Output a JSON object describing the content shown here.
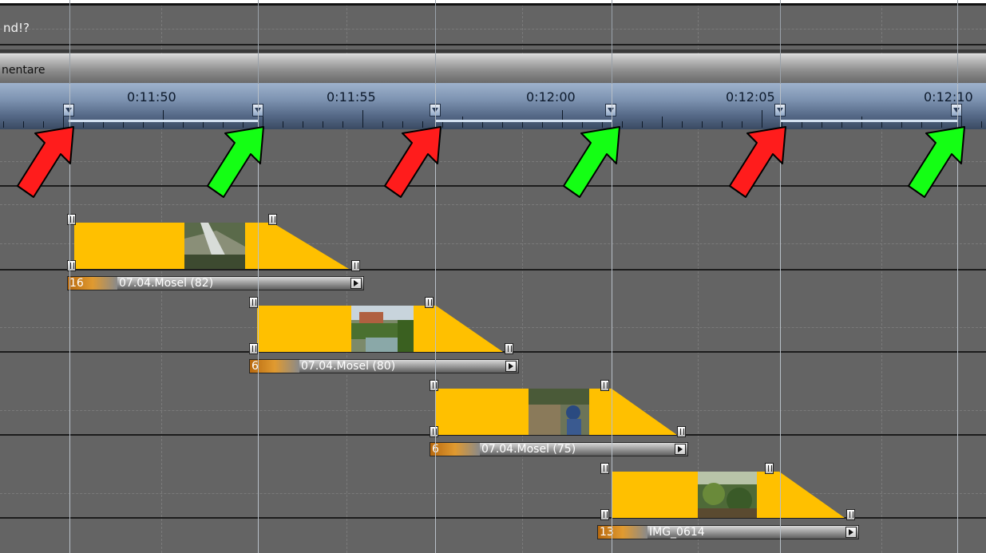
{
  "track_title": "nd!?",
  "comment_track_label": "nentare",
  "ruler": {
    "time_labels": [
      "0:11:50",
      "0:11:55",
      "0:12:00",
      "0:12:05",
      "0:12:10"
    ]
  },
  "annotation_arrows": [
    "red",
    "green",
    "red",
    "green",
    "red",
    "green"
  ],
  "colors": {
    "background": "#646464",
    "clip_fill": "#ffc000",
    "arrow_red": "#ff1c1c",
    "arrow_green": "#14ff14",
    "ruler": "#7e94b2"
  },
  "clips": [
    {
      "number": "16",
      "name": "07.04.Mosel (82)"
    },
    {
      "number": "6",
      "name": "07.04.Mosel (80)"
    },
    {
      "number": "6",
      "name": "07.04.Mosel (75)"
    },
    {
      "number": "13",
      "name": "IMG_0614"
    }
  ]
}
